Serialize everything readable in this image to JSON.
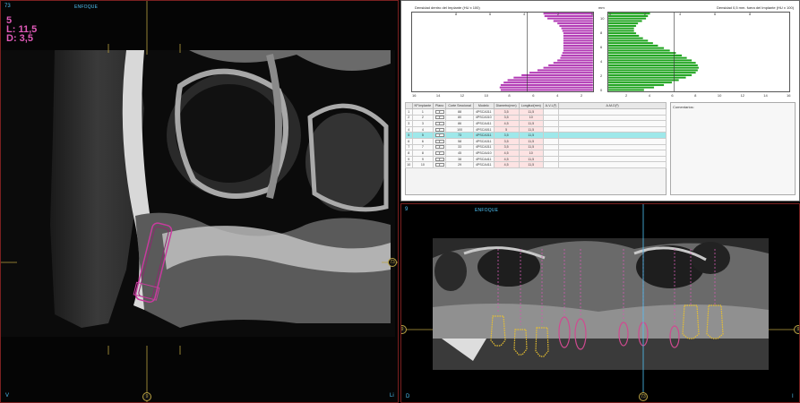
{
  "sagittal": {
    "slice_number": "73",
    "view_label": "ENFOQUE",
    "implant_number": "5",
    "length_text": "L: 11,5",
    "diameter_text": "D: 3,5",
    "corner_bottom_left": "V",
    "corner_bottom_right": "Li",
    "marker_bottom": "9",
    "marker_right": "73"
  },
  "density": {
    "left_title": "Densidad dentro del Implante (HU x 100)",
    "right_title": "Densidad 0,5 mm. fuera del Implante (HU x 100)",
    "unit_label": "mm",
    "top_ticks_left": [
      "8",
      "6",
      "4",
      "2",
      "0"
    ],
    "top_ticks_right": [
      "0",
      "2",
      "4",
      "6",
      "8"
    ],
    "bottom_ticks_left": [
      "16",
      "14",
      "12",
      "10",
      "8",
      "6",
      "4",
      "2"
    ],
    "bottom_ticks_right": [
      "2",
      "4",
      "6",
      "8",
      "10",
      "12",
      "14",
      "16"
    ],
    "y_ticks": [
      "10",
      "8",
      "6",
      "4",
      "2",
      "0"
    ],
    "colors": {
      "inside": "#b23bb5",
      "outside": "#1ea41e"
    },
    "inside_values": [
      5.0,
      4.9,
      4.6,
      4.0,
      3.6,
      3.4,
      3.2,
      3.1,
      3.0,
      3.0,
      3.0,
      3.0,
      3.0,
      3.0,
      3.0,
      3.0,
      3.1,
      3.2,
      3.3,
      3.6,
      4.0,
      4.5,
      5.0,
      5.6,
      6.4,
      7.2,
      8.0,
      8.6,
      9.0,
      9.3,
      9.4,
      9.3
    ],
    "outside_values": [
      4.2,
      4.0,
      3.8,
      3.4,
      3.0,
      2.8,
      2.6,
      2.6,
      2.8,
      3.1,
      3.5,
      4.0,
      4.5,
      5.0,
      5.6,
      6.2,
      6.8,
      7.4,
      7.9,
      8.4,
      8.8,
      9.0,
      9.1,
      9.0,
      8.8,
      8.4,
      7.8,
      7.1,
      6.4,
      5.6,
      4.6,
      3.6
    ]
  },
  "table": {
    "headers": [
      "Nº Implante",
      "Plano",
      "Corte Seccional",
      "Modelo",
      "Diametro(mm)",
      "Longitud(mm)",
      "A-V-L(º)",
      "A-M-D(º)"
    ],
    "plano_symbol": "▾",
    "rows": [
      {
        "n": "1",
        "code": "1",
        "corte": "88",
        "modelo": "4PSCA311",
        "diam": "3,5",
        "len": "11,5"
      },
      {
        "n": "2",
        "code": "2",
        "corte": "80",
        "modelo": "4PSCA310",
        "diam": "3,5",
        "len": "10"
      },
      {
        "n": "3",
        "code": "3",
        "corte": "86",
        "modelo": "4PSCA411",
        "diam": "4,5",
        "len": "11,5"
      },
      {
        "n": "4",
        "code": "4",
        "corte": "100",
        "modelo": "4PSCA511",
        "diam": "5",
        "len": "11,5"
      },
      {
        "n": "5",
        "code": "5",
        "corte": "73",
        "modelo": "4PSCA311",
        "diam": "3,5",
        "len": "11,5"
      },
      {
        "n": "6",
        "code": "6",
        "corte": "58",
        "modelo": "4PSCA311",
        "diam": "3,5",
        "len": "11,5"
      },
      {
        "n": "7",
        "code": "7",
        "corte": "33",
        "modelo": "4PSCA311",
        "diam": "3,5",
        "len": "11,5"
      },
      {
        "n": "8",
        "code": "8",
        "corte": "45",
        "modelo": "4PSCA410",
        "diam": "4,5",
        "len": "10"
      },
      {
        "n": "9",
        "code": "9",
        "corte": "38",
        "modelo": "4PSCA411",
        "diam": "4,5",
        "len": "11,5"
      },
      {
        "n": "10",
        "code": "10",
        "corte": "29",
        "modelo": "4PSCA411",
        "diam": "4,5",
        "len": "11,5"
      }
    ],
    "comments_label": "Comentarios:"
  },
  "panoramic": {
    "slice_number": "9",
    "view_label": "ENFOQUE",
    "corner_bottom_left": "D",
    "corner_bottom_right": "I",
    "marker_bottom": "73",
    "marker_left": "9",
    "marker_right": "9"
  }
}
